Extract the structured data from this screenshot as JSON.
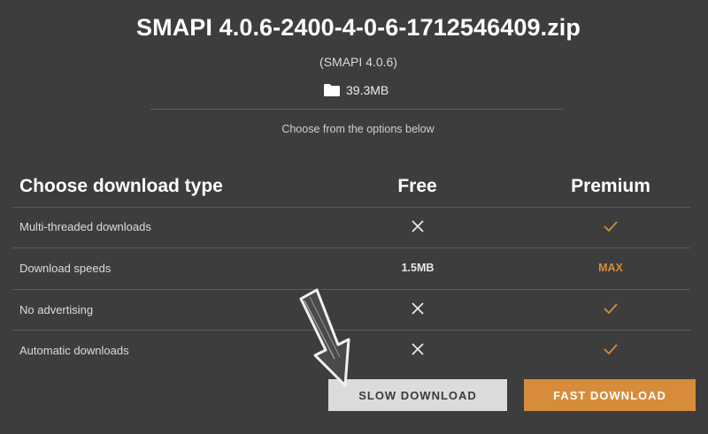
{
  "file": {
    "name": "SMAPI 4.0.6-2400-4-0-6-1712546409.zip",
    "version": "(SMAPI 4.0.6)",
    "size": "39.3MB",
    "size_icon": "folder-icon"
  },
  "instructions": "Choose from the options below",
  "table": {
    "headers": {
      "type": "Choose download type",
      "free": "Free",
      "premium": "Premium"
    },
    "rows": [
      {
        "label": "Multi-threaded downloads",
        "free": "cross",
        "premium": "check"
      },
      {
        "label": "Download speeds",
        "free": "1.5MB",
        "premium": "MAX"
      },
      {
        "label": "No advertising",
        "free": "cross",
        "premium": "check"
      },
      {
        "label": "Automatic downloads",
        "free": "cross",
        "premium": "check"
      }
    ]
  },
  "buttons": {
    "slow": "SLOW DOWNLOAD",
    "fast": "FAST DOWNLOAD"
  },
  "colors": {
    "background": "#3d3d3d",
    "accent": "#d68c3a",
    "slow_button": "#dcdcdc"
  }
}
